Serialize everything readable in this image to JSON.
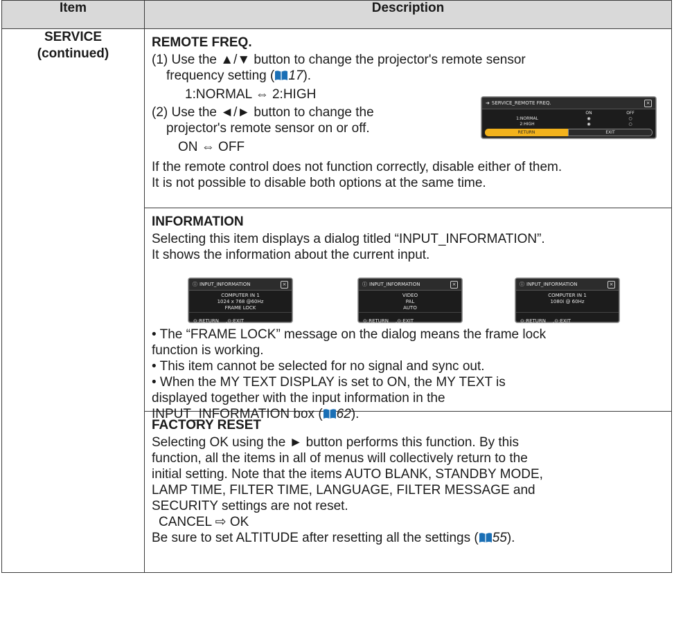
{
  "header": {
    "item": "Item",
    "description": "Description"
  },
  "item": {
    "line1": "SERVICE",
    "line2": "(continued)"
  },
  "remote_freq": {
    "title": "REMOTE FREQ.",
    "step1a": "(1) Use the ▲/▼ button to change the projector's remote sensor",
    "step1b": "frequency setting (",
    "step1_ref": "17",
    "step1_end": ").",
    "opt1": "1:NORMAL ⇔ 2:HIGH",
    "step2a": "(2) Use the ◄/► button to change the",
    "step2b": "projector's remote sensor on or off.",
    "opt2": "ON ⇔ OFF",
    "note1": "If the remote control does not function correctly, disable either of them.",
    "note2": "It is not possible to disable both options at the same time.",
    "osd": {
      "title": "SERVICE_REMOTE FREQ.",
      "col_on": "ON",
      "col_off": "OFF",
      "row1": "1:NORMAL",
      "row2": "2:HIGH",
      "return": "RETURN",
      "exit": "EXIT"
    }
  },
  "information": {
    "title": "INFORMATION",
    "desc1": "Selecting this item displays a dialog titled “INPUT_INFORMATION”.",
    "desc2": "It shows the information about the current input.",
    "dialogs": [
      {
        "title": "INPUT_INFORMATION",
        "l1": "COMPUTER IN 1",
        "l2": "1024 x 768 @60Hz",
        "l3": "FRAME LOCK",
        "ret": ":RETURN",
        "exit": ":EXIT"
      },
      {
        "title": "INPUT_INFORMATION",
        "l1": "VIDEO",
        "l2": "PAL",
        "l3": "AUTO",
        "ret": ":RETURN",
        "exit": ":EXIT"
      },
      {
        "title": "INPUT_INFORMATION",
        "l1": "COMPUTER IN 1",
        "l2": "1080i @ 60Hz",
        "l3": "",
        "ret": ":RETURN",
        "exit": ":EXIT"
      }
    ],
    "b1a": "• The “FRAME LOCK” message on the dialog means the frame lock",
    "b1b": "function is working.",
    "b2": "• This item cannot be selected for no signal and sync out.",
    "b3a": "• When the MY TEXT DISPLAY is set to ON, the MY TEXT is",
    "b3b": "displayed together with the input information in the",
    "b3c": "INPUT_INFORMATION box (",
    "b3_ref": "62",
    "b3_end": ")."
  },
  "factory_reset": {
    "title": "FACTORY RESET",
    "l1": "Selecting OK using the ► button performs this function. By this",
    "l2": "function, all the items in all of menus will collectively return to the",
    "l3": "initial setting. Note that the items AUTO BLANK, STANDBY MODE,",
    "l4": "LAMP TIME, FILTER TIME, LANGUAGE, FILTER MESSAGE and",
    "l5": "SECURITY settings are not reset.",
    "opt": "CANCEL ⇨ OK",
    "last": "Be sure to set ALTITUDE after resetting all the settings (",
    "ref": "55",
    "last_end": ")."
  },
  "colors": {
    "header_bg": "#d9d9d9",
    "book_icon": "#1a6fb5",
    "osd_accent": "#f2b21c"
  }
}
